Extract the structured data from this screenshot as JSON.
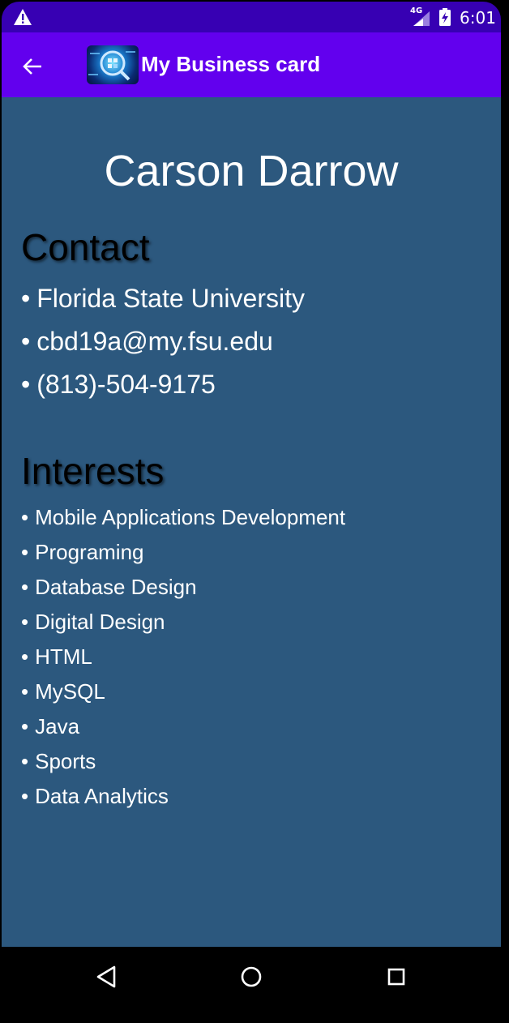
{
  "status_bar": {
    "network": "4G",
    "time": "6:01",
    "icons": [
      "warning-icon",
      "signal-icon",
      "battery-charging-icon"
    ]
  },
  "app_bar": {
    "title": "My Business card",
    "back_icon": "arrow-back-icon",
    "logo": "app-logo-icon"
  },
  "card": {
    "name": "Carson Darrow",
    "contact_heading": "Contact",
    "contact_items": [
      "Florida State University",
      "cbd19a@my.fsu.edu",
      "(813)-504-9175"
    ],
    "interests_heading": "Interests",
    "interests": [
      "Mobile Applications Development",
      "Programing",
      "Database Design",
      "Digital Design",
      "HTML",
      "MySQL",
      "Java",
      "Sports",
      "Data Analytics"
    ],
    "bullet": "•"
  },
  "nav_bar": {
    "icons": [
      "back-triangle-icon",
      "home-circle-icon",
      "recents-square-icon"
    ]
  },
  "colors": {
    "status_bar": "#3700b3",
    "app_bar": "#6200ee",
    "content_background": "#2c587e",
    "heading_text": "#000000",
    "body_text": "#ffffff"
  }
}
